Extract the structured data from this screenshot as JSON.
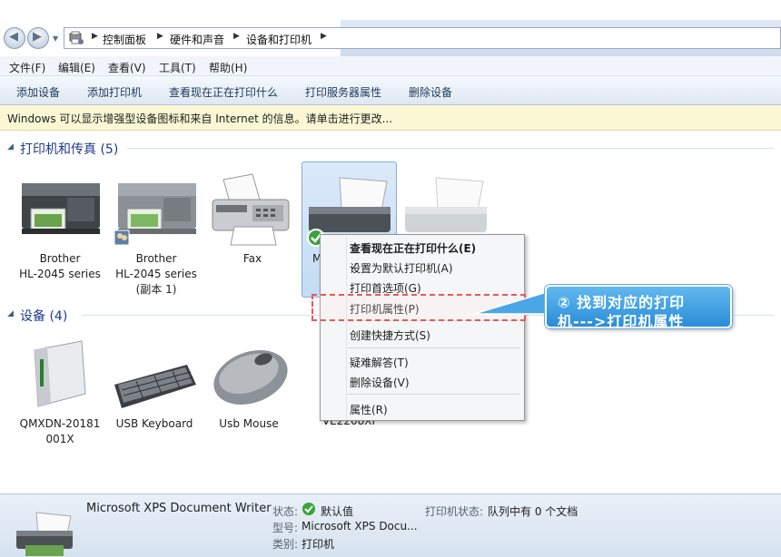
{
  "breadcrumb": [
    "控制面板",
    "硬件和声音",
    "设备和打印机"
  ],
  "menu": [
    "文件(F)",
    "编辑(E)",
    "查看(V)",
    "工具(T)",
    "帮助(H)"
  ],
  "toolbar": [
    "添加设备",
    "添加打印机",
    "查看现在正在打印什么",
    "打印服务器属性",
    "删除设备"
  ],
  "infobar": "Windows 可以显示增强型设备图标和来自 Internet 的信息。请单击进行更改...",
  "sections": {
    "printers": "打印机和传真 (5)",
    "devices": "设备 (4)"
  },
  "printers": [
    {
      "line1": "Brother",
      "line2": "HL-2045 series",
      "line3": ""
    },
    {
      "line1": "Brother",
      "line2": "HL-2045 series",
      "line3": "(副本 1)"
    },
    {
      "line1": "Fax",
      "line2": "",
      "line3": ""
    },
    {
      "line1": "M",
      "line2": "",
      "line3": ""
    }
  ],
  "devices": [
    {
      "line1": "QMXDN-20181",
      "line2": "001X"
    },
    {
      "line1": "USB Keyboard",
      "line2": ""
    },
    {
      "line1": "Usb Mouse",
      "line2": ""
    },
    {
      "line1": "VE2208XI",
      "line2": ""
    }
  ],
  "context_menu": [
    "查看现在正在打印什么(E)",
    "设置为默认打印机(A)",
    "打印首选项(G)",
    "打印机属性(P)",
    "创建快捷方式(S)",
    "疑难解答(T)",
    "删除设备(V)",
    "属性(R)"
  ],
  "callout": {
    "line1": "② 找到对应的打印",
    "line2": "机--->打印机属性"
  },
  "details": {
    "name": "Microsoft XPS Document Writer",
    "status_key": "状态:",
    "status_val": "默认值",
    "model_key": "型号:",
    "model_val": "Microsoft XPS Docu...",
    "category_key": "类别:",
    "category_val": "打印机",
    "printer_status_key": "打印机状态:",
    "printer_status_val": "队列中有 0 个文档"
  },
  "colors": {
    "accent": "#2a8dd8",
    "section_title": "#1e3a8a",
    "highlight_dash": "#e35b5b"
  }
}
